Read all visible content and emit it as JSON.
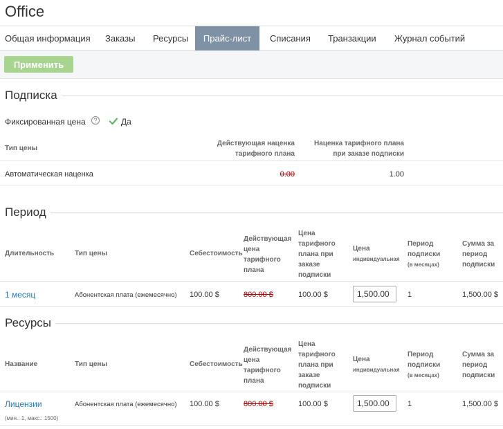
{
  "page_title": "Office",
  "tabs": [
    {
      "label": "Общая информация"
    },
    {
      "label": "Заказы"
    },
    {
      "label": "Ресурсы"
    },
    {
      "label": "Прайс-лист"
    },
    {
      "label": "Списания"
    },
    {
      "label": "Транзакции"
    },
    {
      "label": "Журнал событий"
    }
  ],
  "toolbar": {
    "apply_label": "Применить"
  },
  "subscription": {
    "title": "Подписка",
    "fixed_price_label": "Фиксированная цена",
    "help_symbol": "?",
    "fixed_price_value": "Да",
    "headers": {
      "price_type": "Тип цены",
      "current_markup_1": "Действующая наценка",
      "current_markup_2": "тарифного плана",
      "order_markup_1": "Наценка тарифного плана",
      "order_markup_2": "при заказе подписки"
    },
    "row": {
      "price_type": "Автоматическая наценка",
      "current_markup": "0.00",
      "order_markup": "1.00"
    }
  },
  "period": {
    "title": "Период",
    "headers": {
      "duration": "Длительность",
      "price_type": "Тип цены",
      "cost": "Себестоимость",
      "current_price": [
        "Действующая",
        "цена",
        "тарифного",
        "плана"
      ],
      "order_price": [
        "Цена",
        "тарифного",
        "плана при",
        "заказе",
        "подписки"
      ],
      "individual_price_1": "Цена",
      "individual_price_2": "индивидуальная",
      "period_1": "Период",
      "period_2": "подписки",
      "period_3": "(в месяцах)",
      "sum": [
        "Сумма за",
        "период",
        "подписки"
      ]
    },
    "row": {
      "duration": "1 месяц",
      "price_type": "Абонентская плата (ежемесячно)",
      "cost": "100.00 $",
      "current_price": "800.00 $",
      "order_price": "100.00 $",
      "individual_price": "1,500.00",
      "months": "1",
      "sum": "1,500.00 $"
    }
  },
  "resources": {
    "title": "Ресурсы",
    "headers": {
      "name": "Название",
      "price_type": "Тип цены",
      "cost": "Себестоимость",
      "current_price": [
        "Действующая",
        "цена",
        "тарифного",
        "плана"
      ],
      "order_price": [
        "Цена",
        "тарифного",
        "плана при",
        "заказе",
        "подписки"
      ],
      "individual_price_1": "Цена",
      "individual_price_2": "индивидуальная",
      "period_1": "Период",
      "period_2": "подписки",
      "period_3": "(в месяцах)",
      "sum": [
        "Сумма за",
        "период",
        "подписки"
      ]
    },
    "row": {
      "name": "Лицензии",
      "limits": "(мин.: 1, макс.: 1500)",
      "price_type": "Абонентская плата (ежемесячно)",
      "cost": "100.00 $",
      "current_price": "800.00 $",
      "order_price": "100.00 $",
      "individual_price": "1,500.00",
      "months": "1",
      "sum": "1,500.00 $"
    }
  },
  "colors": {
    "active_tab": "#7f91a5",
    "apply_button": "#a7d590",
    "link": "#2a7ab8",
    "strike": "#b00000",
    "check": "#5cb85c"
  }
}
